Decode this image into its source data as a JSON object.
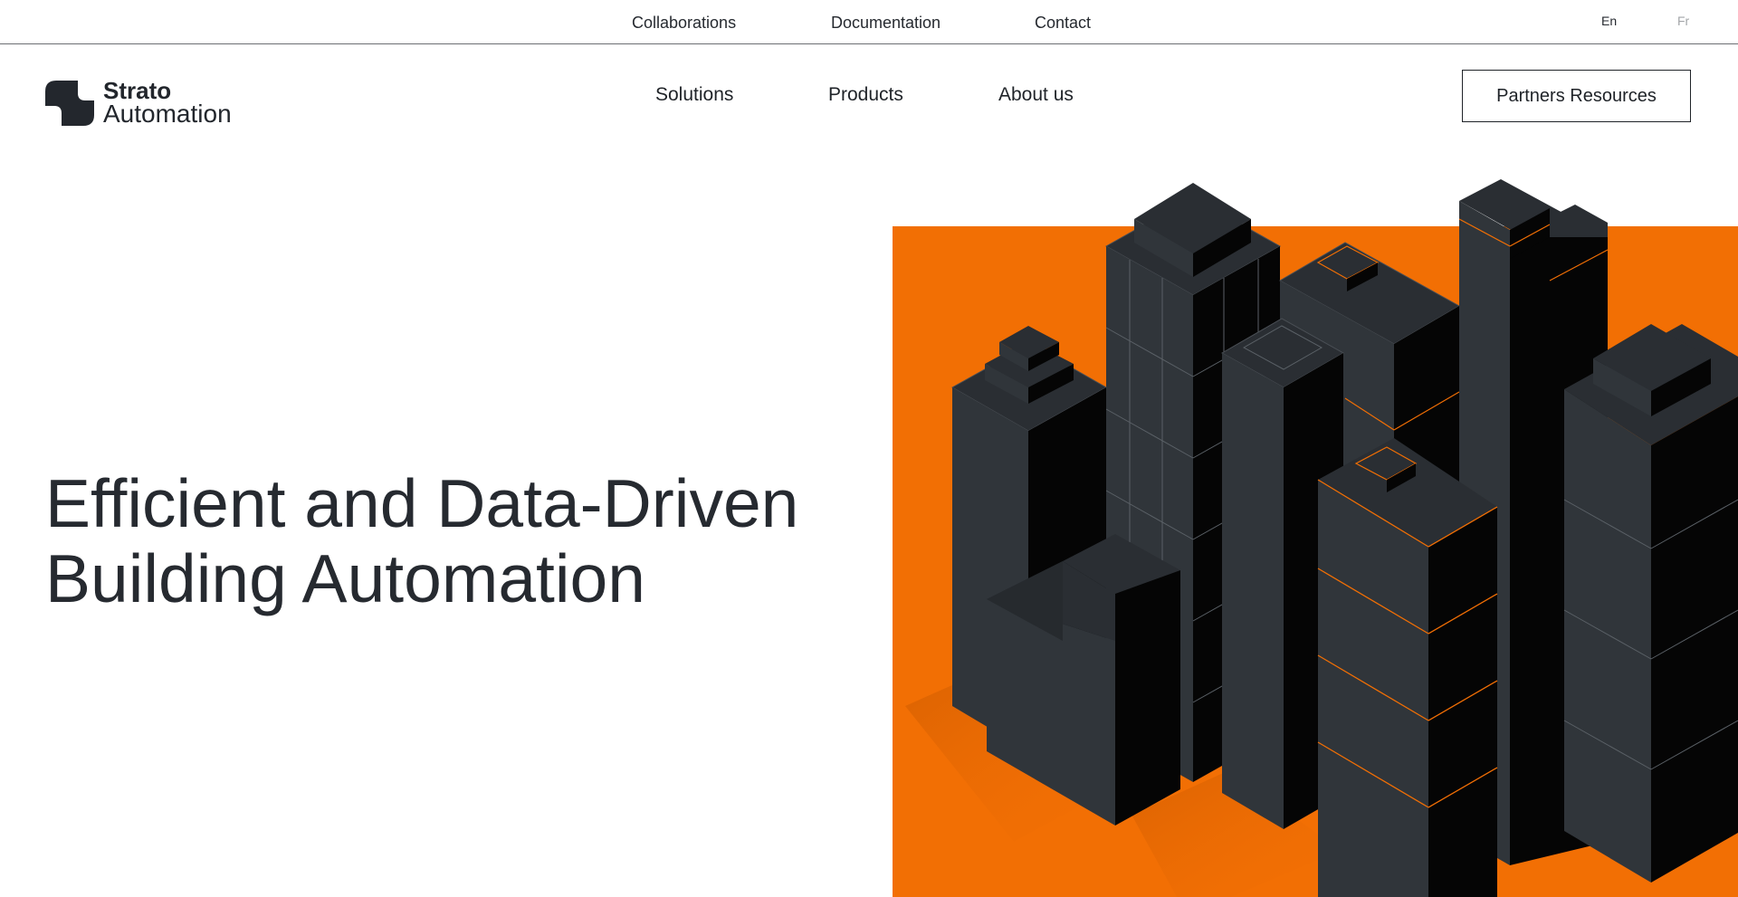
{
  "topbar": {
    "links": [
      {
        "label": "Collaborations"
      },
      {
        "label": "Documentation"
      },
      {
        "label": "Contact"
      }
    ],
    "languages": [
      {
        "code": "En",
        "active": true
      },
      {
        "code": "Fr",
        "active": false
      }
    ]
  },
  "header": {
    "logo": {
      "line1": "Strato",
      "line2": "Automation"
    },
    "nav": [
      {
        "label": "Solutions"
      },
      {
        "label": "Products"
      },
      {
        "label": "About us"
      }
    ],
    "cta_label": "Partners Resources"
  },
  "hero": {
    "title_line1": "Efficient and Data-Driven",
    "title_line2": "Building Automation",
    "illustration": "isometric-city-buildings",
    "accent_color": "#f26f04"
  },
  "colors": {
    "text": "#262a30",
    "building_light": "#30353a",
    "building_dark": "#050505",
    "building_top": "#2a2e33",
    "accent": "#f26f04"
  }
}
